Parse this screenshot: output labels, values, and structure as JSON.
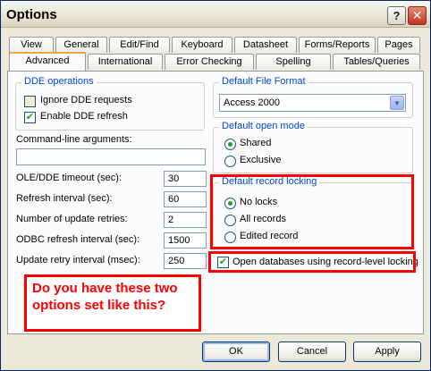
{
  "window": {
    "title": "Options"
  },
  "tabs_back": [
    "View",
    "General",
    "Edit/Find",
    "Keyboard",
    "Datasheet",
    "Forms/Reports",
    "Pages"
  ],
  "tabs_front": [
    "Advanced",
    "International",
    "Error Checking",
    "Spelling",
    "Tables/Queries"
  ],
  "dde": {
    "title": "DDE operations",
    "ignore_label": "Ignore DDE requests",
    "ignore_checked": false,
    "enable_label": "Enable DDE refresh",
    "enable_checked": true
  },
  "cmdline": {
    "label": "Command-line arguments:",
    "value": ""
  },
  "settings": [
    {
      "label": "OLE/DDE timeout (sec):",
      "value": "30"
    },
    {
      "label": "Refresh interval (sec):",
      "value": "60"
    },
    {
      "label": "Number of update retries:",
      "value": "2"
    },
    {
      "label": "ODBC refresh interval (sec):",
      "value": "1500"
    },
    {
      "label": "Update retry interval (msec):",
      "value": "250"
    }
  ],
  "file_format": {
    "title": "Default File Format",
    "selected": "Access 2000"
  },
  "open_mode": {
    "title": "Default open mode",
    "options": [
      "Shared",
      "Exclusive"
    ],
    "selected": "Shared"
  },
  "record_locking": {
    "title": "Default record locking",
    "options": [
      "No locks",
      "All records",
      "Edited record"
    ],
    "selected": "No locks"
  },
  "record_level": {
    "label": "Open databases using record-level locking",
    "checked": true
  },
  "annotation": {
    "text": "Do you have these two options set like this?"
  },
  "buttons": {
    "ok": "OK",
    "cancel": "Cancel",
    "apply": "Apply"
  },
  "colors": {
    "accent": "#0046d5",
    "annotation": "#ff0000",
    "check": "#21a121"
  }
}
